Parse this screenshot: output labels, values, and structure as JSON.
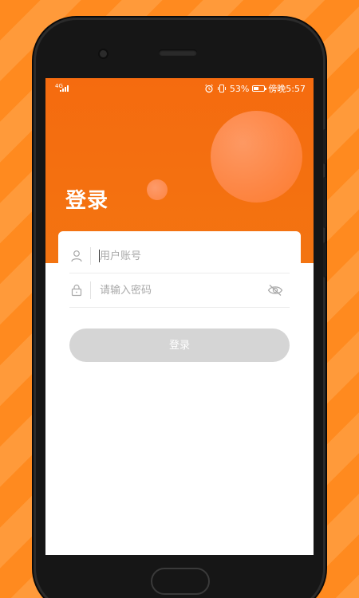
{
  "status_bar": {
    "network_label": "4G",
    "battery_percent": "53%",
    "battery_level": 0.53,
    "time": "傍晚5:57"
  },
  "page": {
    "title": "登录"
  },
  "form": {
    "account_placeholder": "用户账号",
    "password_placeholder": "请输入密码",
    "login_label": "登录"
  },
  "colors": {
    "accent": "#f56b0f",
    "button_disabled": "#d5d5d5",
    "background_stripes": "#ff8a1f"
  },
  "icons": {
    "account": "user-icon",
    "password": "lock-icon",
    "password_toggle": "eye-off-icon",
    "alarm": "alarm-icon",
    "vibrate": "vibrate-icon",
    "battery": "battery-icon"
  }
}
